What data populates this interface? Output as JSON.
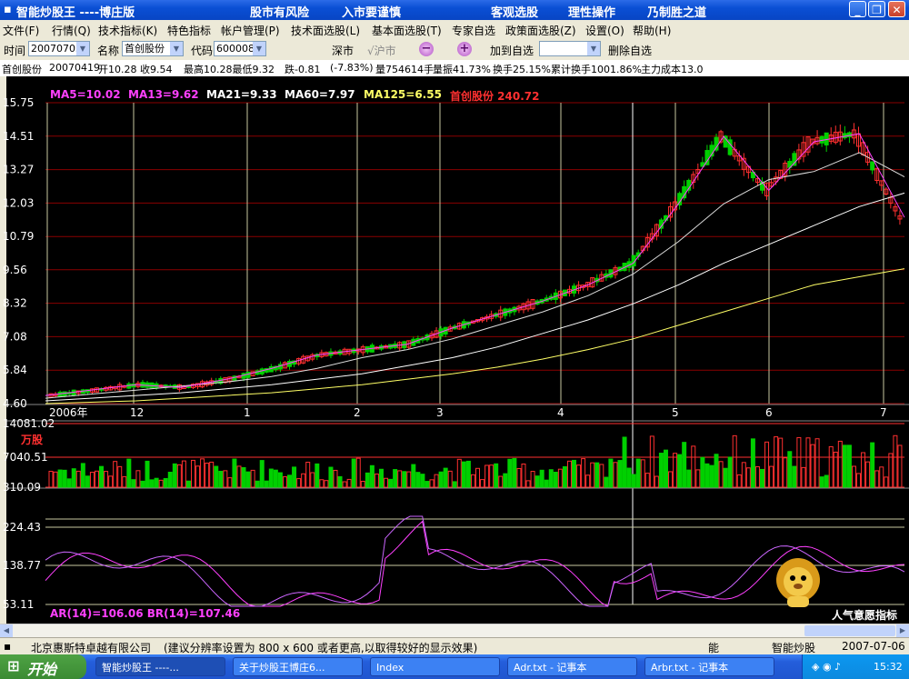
{
  "window": {
    "title_left": "智能炒股王 ----博庄版",
    "slogans": [
      "股市有风险",
      "入市要谨慎",
      "客观选股",
      "理性操作",
      "乃制胜之道"
    ]
  },
  "menu": [
    "文件(F)",
    "行情(Q)",
    "技术指标(K)",
    "特色指标",
    "帐户管理(P)",
    "技术面选股(L)",
    "基本面选股(T)",
    "专家自选",
    "政策面选股(Z)",
    "设置(O)",
    "帮助(H)"
  ],
  "toolbar": {
    "time_label": "时间",
    "time_value": "20070705",
    "name_label": "名称",
    "name_value": "首创股份",
    "code_label": "代码",
    "code_value": "600008",
    "market_sh": "深市",
    "market_sz": "√沪市",
    "minus": "−",
    "plus": "+",
    "add_fav": "加到自选",
    "del_fav": "删除自选"
  },
  "info": {
    "stock": "首创股份",
    "date": "20070419",
    "open": "开10.28",
    "close": "收9.54",
    "highlow": "最高10.28最低9.32",
    "change": "跌-0.81",
    "pct": "(-7.83%)",
    "volume": "量754614手",
    "amplitude": "量振41.73%",
    "turnover": "换手25.15%",
    "cumturn": "累计换手1001.86%",
    "cost": "主力成本13.0"
  },
  "chart_data": [
    {
      "type": "candlestick",
      "title": "",
      "legend": [
        {
          "name": "MA5=10.02",
          "color": "#ff40ff"
        },
        {
          "name": "MA13=9.62",
          "color": "#ff40ff"
        },
        {
          "name": "MA21=9.33",
          "color": "#ffffff"
        },
        {
          "name": "MA60=7.97",
          "color": "#ffffff"
        },
        {
          "name": "MA125=6.55",
          "color": "#ffff66"
        },
        {
          "name": "首创股份 240.72",
          "color": "#ff3030"
        }
      ],
      "y_ticks": [
        15.75,
        14.51,
        13.27,
        12.03,
        10.79,
        9.56,
        8.32,
        7.08,
        5.84,
        4.6
      ],
      "ylim": [
        4.6,
        15.75
      ],
      "x_ticks": [
        "2006年",
        "12",
        "1",
        "2",
        "3",
        "4",
        "5",
        "6",
        "7"
      ],
      "series": [
        {
          "name": "MA125",
          "values": [
            4.6,
            4.65,
            4.7,
            4.8,
            4.9,
            5.0,
            5.15,
            5.3,
            5.5,
            5.7,
            5.95,
            6.25,
            6.6,
            7.0,
            7.5,
            8.0,
            8.5,
            9.0,
            9.3,
            9.6
          ]
        },
        {
          "name": "MA60",
          "values": [
            4.7,
            4.8,
            4.9,
            5.0,
            5.15,
            5.3,
            5.5,
            5.7,
            6.0,
            6.3,
            6.7,
            7.2,
            7.7,
            8.3,
            9.0,
            9.8,
            10.5,
            11.2,
            11.9,
            12.4
          ]
        },
        {
          "name": "MA21",
          "values": [
            4.8,
            4.95,
            5.1,
            5.25,
            5.4,
            5.6,
            5.9,
            6.3,
            6.6,
            7.0,
            7.5,
            8.0,
            8.6,
            9.4,
            10.6,
            12.0,
            12.9,
            13.2,
            13.9,
            13.0
          ]
        },
        {
          "name": "MA5",
          "values": [
            4.9,
            5.1,
            5.3,
            5.2,
            5.5,
            5.9,
            6.4,
            6.6,
            6.8,
            7.4,
            7.9,
            8.4,
            9.0,
            9.8,
            12.0,
            14.5,
            12.5,
            14.3,
            14.6,
            11.5
          ]
        }
      ]
    },
    {
      "type": "bar",
      "title": "",
      "unit": "万股",
      "y_ticks": [
        14081.02,
        7040.51,
        310.09
      ],
      "ylim": [
        310.09,
        14081.02
      ]
    },
    {
      "type": "line",
      "title": "",
      "y_ticks": [
        224.43,
        138.77,
        53.11
      ],
      "ylim": [
        53.11,
        280
      ],
      "legend": [
        {
          "name": "AR(14)=106.06",
          "color": "#ff40ff"
        },
        {
          "name": "BR(14)=107.46",
          "color": "#ff40ff"
        }
      ],
      "watermark": "人气意愿指标"
    }
  ],
  "status": {
    "company": "北京惠斯特卓越有限公司",
    "tip": "(建议分辨率设置为 800 x 600 或者更高,以取得较好的显示效果)",
    "mode": "能",
    "app": "智能炒股",
    "date": "2007-07-06"
  },
  "taskbar": {
    "start": "开始",
    "items": [
      "智能炒股王 ----...",
      "关于炒股王博庄6...",
      "Index",
      "Adr.txt - 记事本",
      "Arbr.txt - 记事本"
    ],
    "clock": "15:32"
  },
  "colors": {
    "up": "#ff3030",
    "down": "#00d000",
    "grid": "#7a0000",
    "axis": "#ffffff"
  }
}
